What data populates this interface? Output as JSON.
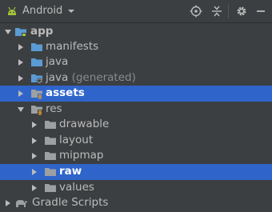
{
  "toolbar": {
    "title": "Android",
    "icons": [
      "android-icon",
      "dropdown-caret-icon",
      "locate-icon",
      "collapse-all-icon",
      "settings-gear-icon",
      "hide-panel-icon"
    ]
  },
  "tree": [
    {
      "label": "app",
      "depth": 0,
      "expanded": true,
      "icon": "module-folder",
      "bold": true
    },
    {
      "label": "manifests",
      "depth": 1,
      "expanded": false,
      "icon": "folder"
    },
    {
      "label": "java",
      "depth": 1,
      "expanded": false,
      "icon": "folder"
    },
    {
      "label": "java",
      "suffix": "(generated)",
      "depth": 1,
      "expanded": false,
      "icon": "generated-folder"
    },
    {
      "label": "assets",
      "depth": 1,
      "expanded": false,
      "icon": "assets-folder",
      "selected": true,
      "bold": true
    },
    {
      "label": "res",
      "depth": 1,
      "expanded": true,
      "icon": "res-folder"
    },
    {
      "label": "drawable",
      "depth": 2,
      "expanded": false,
      "icon": "folder"
    },
    {
      "label": "layout",
      "depth": 2,
      "expanded": false,
      "icon": "folder"
    },
    {
      "label": "mipmap",
      "depth": 2,
      "expanded": false,
      "icon": "folder"
    },
    {
      "label": "raw",
      "depth": 2,
      "expanded": false,
      "icon": "folder",
      "selected": true,
      "bold": true
    },
    {
      "label": "values",
      "depth": 2,
      "expanded": false,
      "icon": "folder"
    },
    {
      "label": "Gradle Scripts",
      "depth": 0,
      "expanded": false,
      "icon": "gradle"
    }
  ],
  "colors": {
    "background": "#3c3f41",
    "selection": "#2f65ca",
    "folder_blue": "#5b9bd5",
    "folder_gray": "#9da0a3",
    "android_green": "#a4c639"
  }
}
